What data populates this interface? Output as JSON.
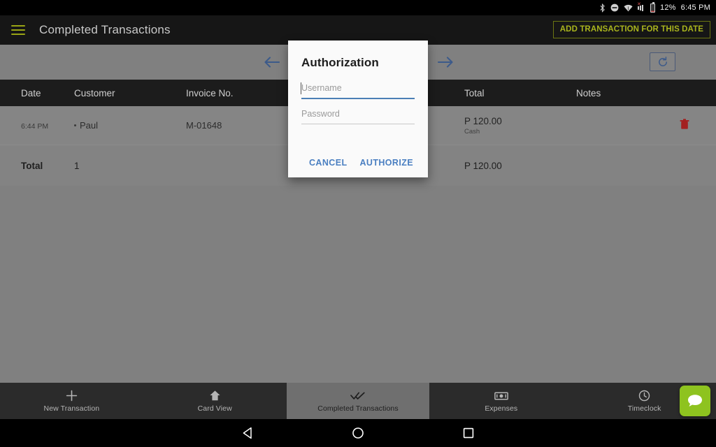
{
  "status_bar": {
    "bluetooth_icon": "bluetooth-icon",
    "dnd_icon": "do-not-disturb-icon",
    "wifi_icon": "wifi-icon",
    "signal_icon": "cell-signal-no-service-icon",
    "battery_icon": "battery-low-icon",
    "battery_percent": "12%",
    "clock": "6:45 PM"
  },
  "app_bar": {
    "menu_icon": "hamburger-menu-icon",
    "title": "Completed Transactions",
    "add_transaction_label": "ADD TRANSACTION FOR THIS DATE",
    "accent_color": "#a9b41d"
  },
  "sub_toolbar": {
    "prev_icon": "arrow-left-icon",
    "next_icon": "arrow-right-icon",
    "refresh_icon": "refresh-icon",
    "arrow_color": "#3c5a8a"
  },
  "table": {
    "headers": {
      "date": "Date",
      "customer": "Customer",
      "invoice": "Invoice No.",
      "status": "",
      "total": "Total",
      "notes": "Notes"
    },
    "rows": [
      {
        "time": "6:44 PM",
        "customer": "Paul",
        "invoice": "M-01648",
        "status": "",
        "amount": "P 120.00",
        "pay_type": "Cash",
        "notes": "",
        "delete_icon": "trash-icon"
      }
    ],
    "summary": {
      "label": "Total",
      "count": "1",
      "amount": "P 120.00"
    }
  },
  "dialog": {
    "title": "Authorization",
    "username_placeholder": "Username",
    "password_placeholder": "Password",
    "cancel_label": "CANCEL",
    "authorize_label": "AUTHORIZE",
    "accent_color": "#4a7fc1"
  },
  "bottom_nav": {
    "items": [
      {
        "label": "New Transaction",
        "icon": "plus-icon",
        "active": false
      },
      {
        "label": "Card View",
        "icon": "home-icon",
        "active": false
      },
      {
        "label": "Completed Transactions",
        "icon": "double-check-icon",
        "active": true
      },
      {
        "label": "Expenses",
        "icon": "banknote-icon",
        "active": false
      },
      {
        "label": "Timeclock",
        "icon": "clock-icon",
        "active": false
      }
    ],
    "fab_icon": "chat-bubble-icon",
    "fab_color": "#8ec31f"
  },
  "android_nav": {
    "back_icon": "back-triangle-icon",
    "home_icon": "home-circle-icon",
    "recents_icon": "recents-square-icon"
  }
}
